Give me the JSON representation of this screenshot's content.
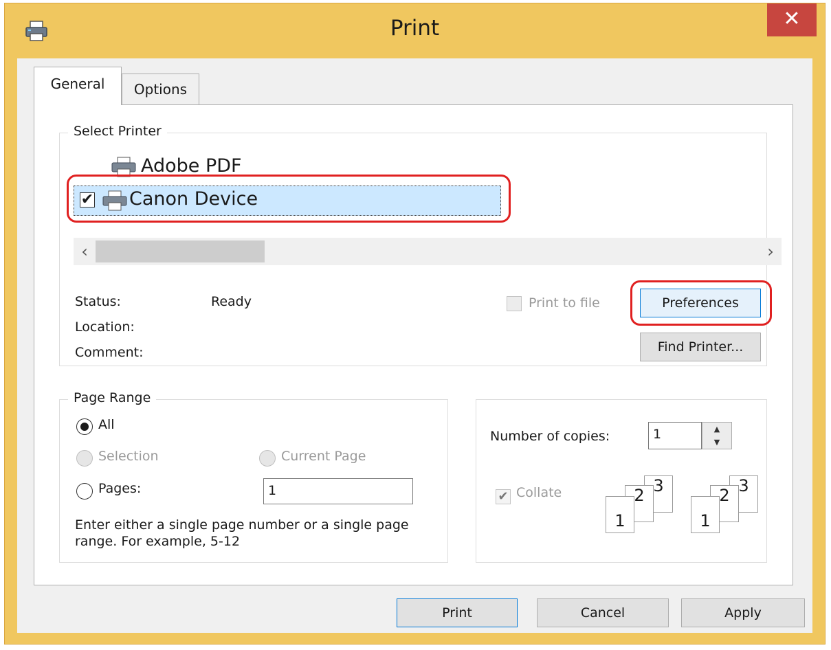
{
  "window": {
    "title": "Print",
    "close_glyph": "✕"
  },
  "tabs": [
    {
      "label": "General",
      "selected": true
    },
    {
      "label": "Options",
      "selected": false
    }
  ],
  "select_printer": {
    "legend": "Select Printer",
    "printers": [
      {
        "name": "Adobe PDF",
        "icon": "printer-icon",
        "selected": false
      },
      {
        "name": "Canon Device",
        "icon": "printer-icon",
        "selected": true,
        "default_mark": "✔"
      }
    ],
    "scroll_left": "‹",
    "scroll_right": "›",
    "status_label": "Status:",
    "status_value": "Ready",
    "location_label": "Location:",
    "comment_label": "Comment:",
    "print_to_file_label": "Print to file",
    "preferences_label": "Preferences",
    "find_printer_label": "Find Printer..."
  },
  "page_range": {
    "legend": "Page Range",
    "all_label": "All",
    "selection_label": "Selection",
    "current_page_label": "Current Page",
    "pages_label": "Pages:",
    "pages_value": "1",
    "hint": "Enter either a single page number or a single page range.  For example, 5-12",
    "selected": "All"
  },
  "copies": {
    "label": "Number of copies:",
    "value": "1",
    "collate_label": "Collate",
    "collate_checked": true,
    "collate_pages": [
      "1",
      "2",
      "3"
    ]
  },
  "footer": {
    "print_label": "Print",
    "cancel_label": "Cancel",
    "apply_label": "Apply"
  },
  "colors": {
    "titlebar": "#f0c75f",
    "close_button": "#c7463f",
    "selection": "#cce8ff",
    "annotation": "#e02020"
  }
}
